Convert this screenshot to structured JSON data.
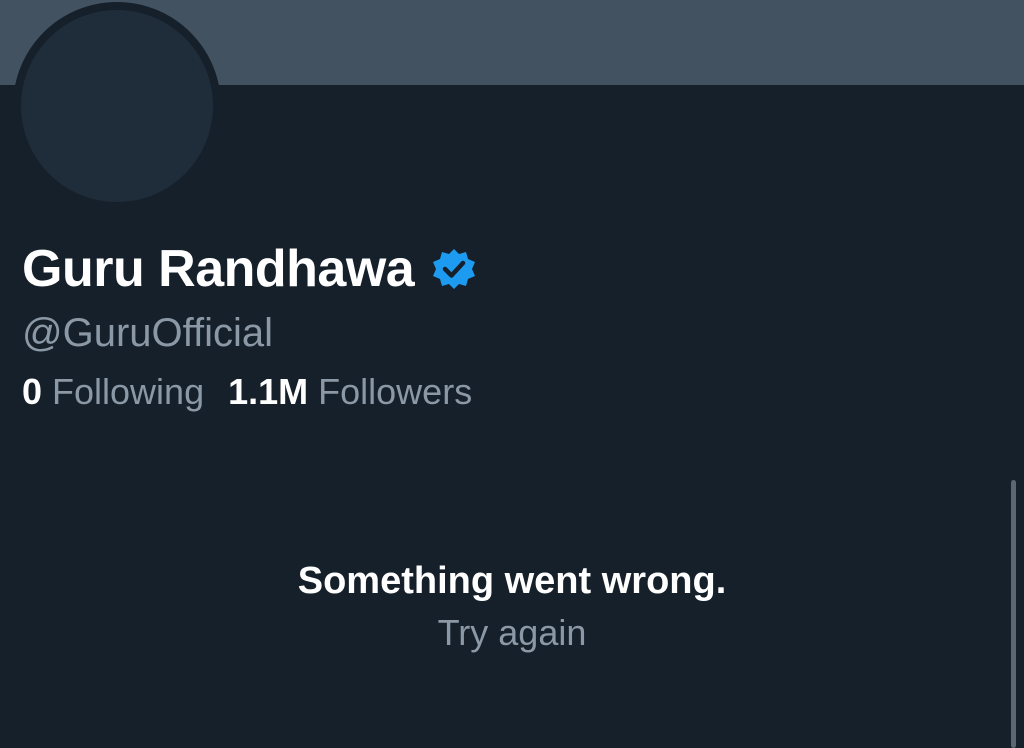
{
  "profile": {
    "display_name": "Guru Randhawa",
    "handle": "@GuruOfficial",
    "verified": true,
    "verified_icon": "verified-badge-icon",
    "following_count": "0",
    "following_label": "Following",
    "followers_count": "1.1M",
    "followers_label": "Followers"
  },
  "error": {
    "title": "Something went wrong.",
    "retry_label": "Try again"
  },
  "colors": {
    "background": "#15202b",
    "banner": "#435260",
    "avatar": "#1f2d3b",
    "verified_blue": "#1d9bf0",
    "text_primary": "#ffffff",
    "text_secondary": "#8b98a5"
  }
}
